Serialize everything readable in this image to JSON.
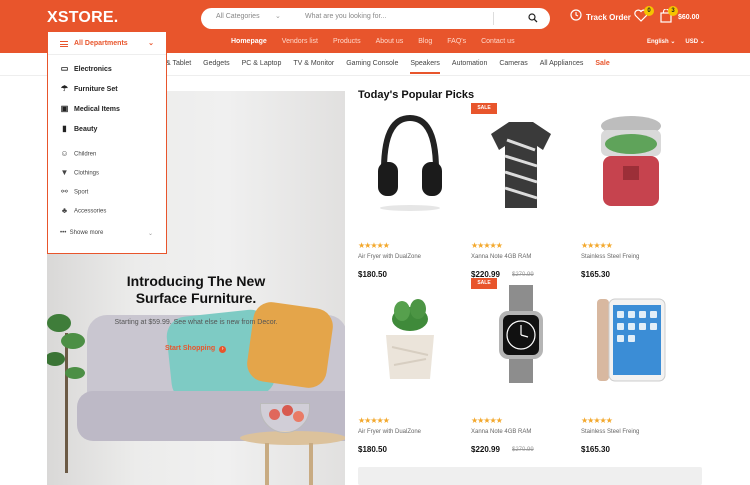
{
  "brand": {
    "logo": "XSTORE."
  },
  "search": {
    "category": "All Categories",
    "placeholder": "What are you looking for..."
  },
  "header": {
    "track_order": "Track Order",
    "wishlist_count": "0",
    "cart_count": "3",
    "cart_total": "$60.00",
    "language": "English",
    "currency": "USD"
  },
  "main_nav": [
    "Homepage",
    "Vendors list",
    "Products",
    "About us",
    "Blog",
    "FAQ's",
    "Contact us"
  ],
  "category_nav": [
    "& Tablet",
    "Gedgets",
    "PC & Laptop",
    "TV & Monitor",
    "Gaming Console",
    "Speakers",
    "Automation",
    "Cameras",
    "All Appliances",
    "Sale"
  ],
  "departments": {
    "title": "All Departments",
    "primary": [
      "Electronics",
      "Furniture Set",
      "Medical Items",
      "Beauty"
    ],
    "secondary": [
      "Children",
      "Clothings",
      "Sport",
      "Accessories"
    ],
    "show_more": "Showe more"
  },
  "hero": {
    "title_line1": "Introducing The New",
    "title_line2": "Surface Furniture.",
    "subtitle": "Starting at $59.99. See what else is new from Decor.",
    "cta": "Start Shopping"
  },
  "picks": {
    "title": "Today's Popular Picks",
    "sale_label": "SALE",
    "products": [
      {
        "name": "Air Fryer with DualZone",
        "price": "$180.50",
        "old_price": "",
        "stars": "★★★★★"
      },
      {
        "name": "Xanna Note 4GB RAM",
        "price": "$220.99",
        "old_price": "$270.99",
        "stars": "★★★★★"
      },
      {
        "name": "Stainless Steel Freing",
        "price": "$165.30",
        "old_price": "",
        "stars": "★★★★★"
      },
      {
        "name": "Air Fryer with DualZone",
        "price": "$180.50",
        "old_price": "",
        "stars": "★★★★★"
      },
      {
        "name": "Xanna Note 4GB RAM",
        "price": "$220.99",
        "old_price": "$270.99",
        "stars": "★★★★★"
      },
      {
        "name": "Stainless Steel Freing",
        "price": "$165.30",
        "old_price": "",
        "stars": "★★★★★"
      }
    ]
  },
  "colors": {
    "accent": "#e8552c",
    "star": "#f3a82c",
    "badge": "#f5c400"
  }
}
